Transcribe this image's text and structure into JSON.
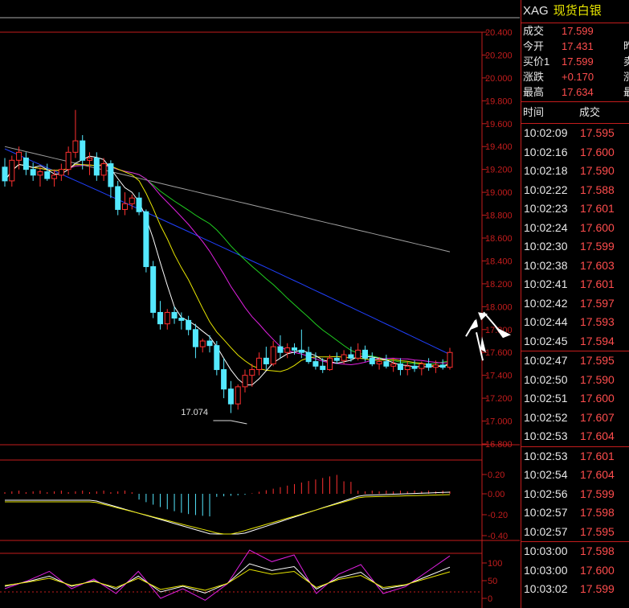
{
  "symbol": {
    "code": "XAG",
    "name": "现货白银"
  },
  "quotes": [
    {
      "label": "成交",
      "value": "17.599",
      "more": ""
    },
    {
      "label": "今开",
      "value": "17.431",
      "more": "昨"
    },
    {
      "label": "买价1",
      "value": "17.599",
      "more": "卖"
    },
    {
      "label": "涨跌",
      "value": "+0.170",
      "more": "涨"
    },
    {
      "label": "最高",
      "value": "17.634",
      "more": "最"
    }
  ],
  "trade_header": {
    "time": "时间",
    "price": "成交"
  },
  "trades": [
    {
      "time": "10:02:09",
      "price": "17.595"
    },
    {
      "time": "10:02:16",
      "price": "17.600"
    },
    {
      "time": "10:02:18",
      "price": "17.590"
    },
    {
      "time": "10:02:22",
      "price": "17.588"
    },
    {
      "time": "10:02:23",
      "price": "17.601"
    },
    {
      "time": "10:02:24",
      "price": "17.600"
    },
    {
      "time": "10:02:30",
      "price": "17.599"
    },
    {
      "time": "10:02:38",
      "price": "17.603"
    },
    {
      "time": "10:02:41",
      "price": "17.601"
    },
    {
      "time": "10:02:42",
      "price": "17.597"
    },
    {
      "time": "10:02:44",
      "price": "17.593"
    },
    {
      "time": "10:02:45",
      "price": "17.594"
    },
    {
      "time": "10:02:47",
      "price": "17.595"
    },
    {
      "time": "10:02:50",
      "price": "17.590"
    },
    {
      "time": "10:02:51",
      "price": "17.600"
    },
    {
      "time": "10:02:52",
      "price": "17.607"
    },
    {
      "time": "10:02:53",
      "price": "17.604"
    },
    {
      "time": "10:02:53",
      "price": "17.601"
    },
    {
      "time": "10:02:54",
      "price": "17.604"
    },
    {
      "time": "10:02:56",
      "price": "17.599"
    },
    {
      "time": "10:02:57",
      "price": "17.598"
    },
    {
      "time": "10:02:57",
      "price": "17.595"
    },
    {
      "time": "10:03:00",
      "price": "17.598"
    },
    {
      "time": "10:03:00",
      "price": "17.600"
    },
    {
      "time": "10:03:02",
      "price": "17.599"
    }
  ],
  "price_axis": [
    "20.400",
    "20.200",
    "20.000",
    "19.800",
    "19.600",
    "19.400",
    "19.200",
    "19.000",
    "18.800",
    "18.600",
    "18.400",
    "18.200",
    "18.000",
    "17.800",
    "17.600",
    "17.400",
    "17.200",
    "17.000",
    "16.800"
  ],
  "macd_axis": [
    "0.20",
    "0.00",
    "-0.20",
    "-0.40"
  ],
  "kdj_axis": [
    "100",
    "50",
    "0"
  ],
  "low_marker": "17.074",
  "chart_data": {
    "type": "candlestick",
    "ylim": [
      16.8,
      20.4
    ],
    "low_label": 17.074,
    "colors": {
      "up": "#ff3030",
      "down": "#54e8ff",
      "ma5": "#ffffff",
      "ma10": "#e8e600",
      "ma20": "#e020e0",
      "ma30": "#20d020",
      "ma60": "#2040ff",
      "ma120": "#a0a0a0"
    },
    "candles": [
      [
        19.22,
        19.3,
        19.05,
        19.1
      ],
      [
        19.1,
        19.32,
        19.05,
        19.28
      ],
      [
        19.28,
        19.4,
        19.2,
        19.35
      ],
      [
        19.3,
        19.35,
        19.15,
        19.2
      ],
      [
        19.2,
        19.26,
        19.1,
        19.15
      ],
      [
        19.15,
        19.22,
        19.05,
        19.18
      ],
      [
        19.18,
        19.25,
        19.1,
        19.12
      ],
      [
        19.12,
        19.2,
        19.05,
        19.15
      ],
      [
        19.15,
        19.25,
        19.1,
        19.2
      ],
      [
        19.2,
        19.4,
        19.15,
        19.35
      ],
      [
        19.35,
        19.72,
        19.3,
        19.45
      ],
      [
        19.45,
        19.5,
        19.2,
        19.28
      ],
      [
        19.28,
        19.35,
        19.15,
        19.3
      ],
      [
        19.3,
        19.35,
        19.1,
        19.15
      ],
      [
        19.15,
        19.3,
        19.1,
        19.25
      ],
      [
        19.25,
        19.28,
        18.95,
        19.05
      ],
      [
        19.05,
        19.1,
        18.8,
        18.85
      ],
      [
        18.85,
        19.0,
        18.8,
        18.9
      ],
      [
        18.9,
        18.98,
        18.85,
        18.95
      ],
      [
        18.95,
        19.0,
        18.8,
        18.83
      ],
      [
        18.83,
        18.85,
        18.3,
        18.35
      ],
      [
        18.35,
        18.4,
        17.9,
        17.95
      ],
      [
        17.95,
        18.05,
        17.8,
        17.85
      ],
      [
        17.85,
        17.98,
        17.8,
        17.95
      ],
      [
        17.95,
        18.0,
        17.85,
        17.9
      ],
      [
        17.9,
        17.95,
        17.8,
        17.88
      ],
      [
        17.88,
        17.92,
        17.75,
        17.8
      ],
      [
        17.8,
        17.85,
        17.55,
        17.65
      ],
      [
        17.65,
        17.72,
        17.6,
        17.7
      ],
      [
        17.7,
        17.75,
        17.6,
        17.66
      ],
      [
        17.66,
        17.7,
        17.4,
        17.45
      ],
      [
        17.45,
        17.55,
        17.2,
        17.28
      ],
      [
        17.28,
        17.35,
        17.07,
        17.15
      ],
      [
        17.15,
        17.32,
        17.1,
        17.3
      ],
      [
        17.3,
        17.45,
        17.25,
        17.4
      ],
      [
        17.4,
        17.5,
        17.3,
        17.45
      ],
      [
        17.45,
        17.6,
        17.4,
        17.55
      ],
      [
        17.55,
        17.65,
        17.45,
        17.5
      ],
      [
        17.5,
        17.7,
        17.48,
        17.65
      ],
      [
        17.65,
        17.75,
        17.55,
        17.6
      ],
      [
        17.6,
        17.68,
        17.55,
        17.64
      ],
      [
        17.64,
        17.68,
        17.58,
        17.62
      ],
      [
        17.62,
        17.8,
        17.55,
        17.6
      ],
      [
        17.6,
        17.65,
        17.5,
        17.52
      ],
      [
        17.52,
        17.6,
        17.45,
        17.48
      ],
      [
        17.48,
        17.55,
        17.42,
        17.45
      ],
      [
        17.45,
        17.58,
        17.44,
        17.55
      ],
      [
        17.55,
        17.6,
        17.5,
        17.53
      ],
      [
        17.53,
        17.62,
        17.5,
        17.58
      ],
      [
        17.58,
        17.65,
        17.52,
        17.55
      ],
      [
        17.55,
        17.68,
        17.53,
        17.62
      ],
      [
        17.62,
        17.66,
        17.52,
        17.55
      ],
      [
        17.55,
        17.6,
        17.48,
        17.5
      ],
      [
        17.5,
        17.56,
        17.45,
        17.52
      ],
      [
        17.52,
        17.58,
        17.46,
        17.48
      ],
      [
        17.48,
        17.55,
        17.43,
        17.5
      ],
      [
        17.5,
        17.55,
        17.4,
        17.45
      ],
      [
        17.45,
        17.52,
        17.4,
        17.48
      ],
      [
        17.48,
        17.53,
        17.43,
        17.46
      ],
      [
        17.46,
        17.52,
        17.4,
        17.5
      ],
      [
        17.5,
        17.55,
        17.44,
        17.47
      ],
      [
        17.47,
        17.53,
        17.42,
        17.49
      ],
      [
        17.49,
        17.54,
        17.45,
        17.47
      ],
      [
        17.47,
        17.64,
        17.45,
        17.6
      ]
    ]
  }
}
